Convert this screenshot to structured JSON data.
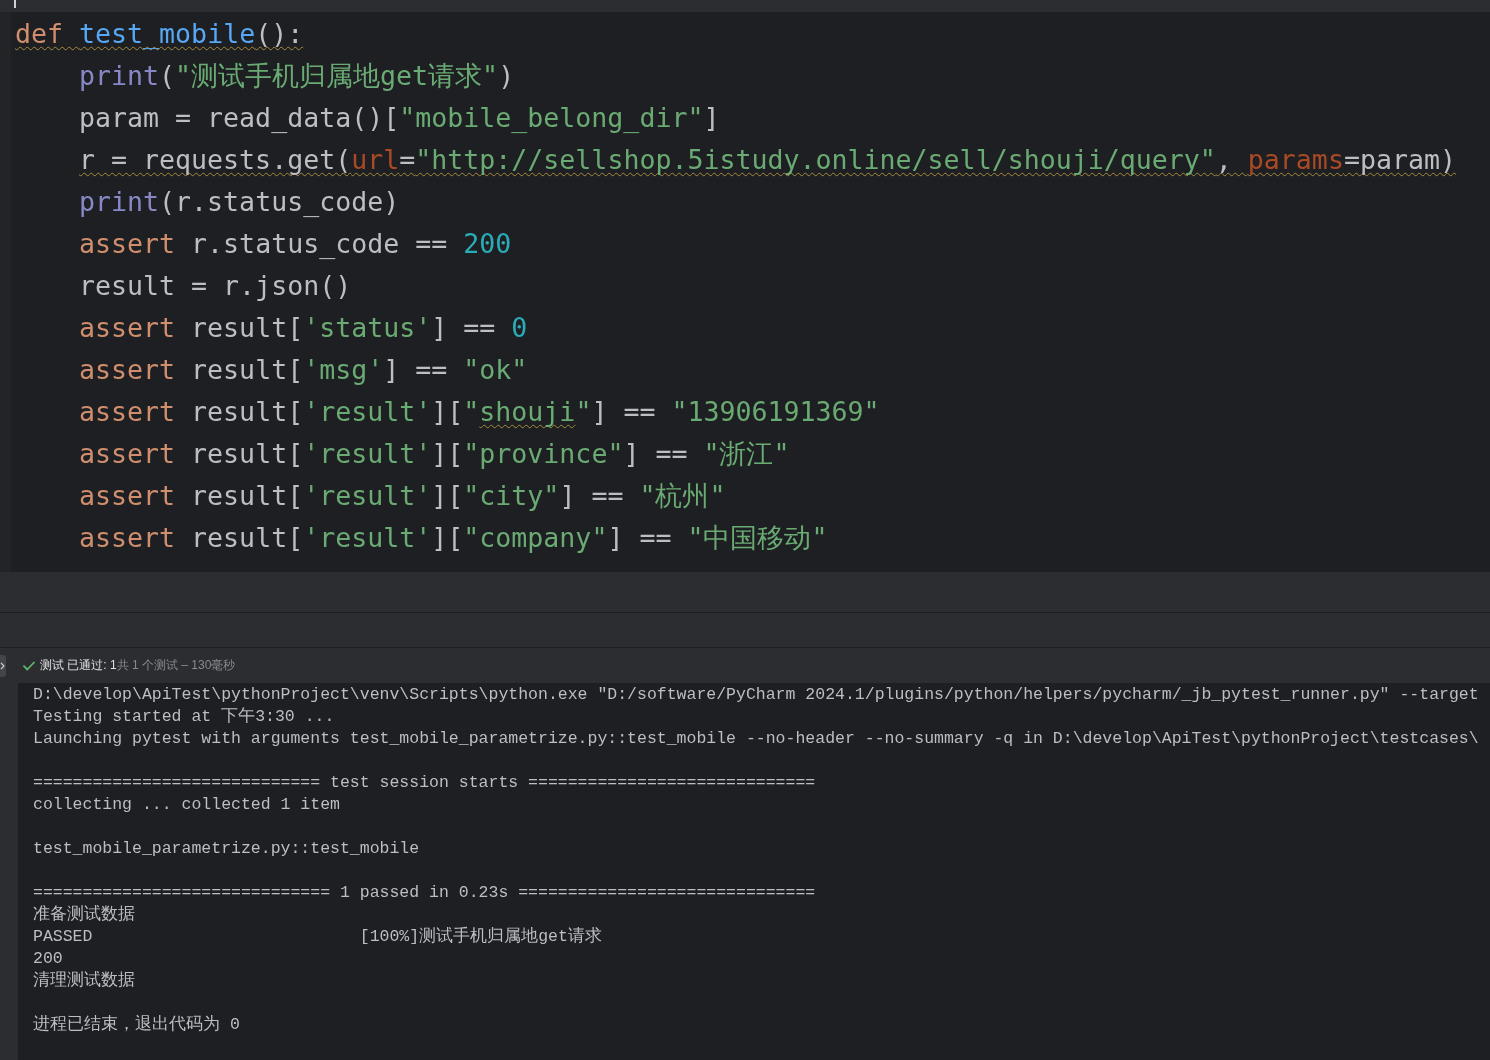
{
  "editor": {
    "code_lines": [
      {
        "tokens": [
          {
            "text": "def ",
            "kind": "keyword",
            "warning": true
          },
          {
            "text": "test_mobile",
            "kind": "function",
            "warning": true
          },
          {
            "text": "():",
            "kind": "plain",
            "warning": true
          }
        ],
        "children": [
          {
            "tokens": [
              {
                "text": "print",
                "kind": "builtin",
                "warning": false
              },
              {
                "text": "(",
                "kind": "plain",
                "warning": false
              },
              {
                "text": "\"测试手机归属地get请求\"",
                "kind": "string",
                "warning": false
              },
              {
                "text": ")",
                "kind": "plain",
                "warning": false
              }
            ]
          },
          {
            "tokens": [
              {
                "text": "param = read_data()[",
                "kind": "plain",
                "warning": false
              },
              {
                "text": "\"mobile_belong_dir\"",
                "kind": "string",
                "warning": false
              },
              {
                "text": "]",
                "kind": "plain",
                "warning": false
              }
            ]
          },
          {
            "tokens": [
              {
                "text": "r = requests.get(",
                "kind": "plain",
                "warning": true
              },
              {
                "text": "url",
                "kind": "param",
                "warning": true
              },
              {
                "text": "=",
                "kind": "plain",
                "warning": true
              },
              {
                "text": "\"http://sellshop.5istudy.online/sell/shouji/query\"",
                "kind": "string",
                "warning": true
              },
              {
                "text": ", ",
                "kind": "plain",
                "warning": true
              },
              {
                "text": "params",
                "kind": "param",
                "warning": true
              },
              {
                "text": "=param)",
                "kind": "plain",
                "warning": true
              }
            ]
          },
          {
            "tokens": [
              {
                "text": "print",
                "kind": "builtin",
                "warning": false
              },
              {
                "text": "(r.status_code)",
                "kind": "plain",
                "warning": false
              }
            ]
          },
          {
            "tokens": [
              {
                "text": "assert",
                "kind": "keyword",
                "warning": false
              },
              {
                "text": " r.status_code == ",
                "kind": "plain",
                "warning": false
              },
              {
                "text": "200",
                "kind": "number",
                "warning": false
              }
            ]
          },
          {
            "tokens": [
              {
                "text": "result = r.json()",
                "kind": "plain",
                "warning": false
              }
            ]
          },
          {
            "tokens": [
              {
                "text": "assert",
                "kind": "keyword",
                "warning": false
              },
              {
                "text": " result[",
                "kind": "plain",
                "warning": false
              },
              {
                "text": "'status'",
                "kind": "string",
                "warning": false
              },
              {
                "text": "] == ",
                "kind": "plain",
                "warning": false
              },
              {
                "text": "0",
                "kind": "number",
                "warning": false
              }
            ]
          },
          {
            "tokens": [
              {
                "text": "assert",
                "kind": "keyword",
                "warning": false
              },
              {
                "text": " result[",
                "kind": "plain",
                "warning": false
              },
              {
                "text": "'msg'",
                "kind": "string",
                "warning": false
              },
              {
                "text": "] == ",
                "kind": "plain",
                "warning": false
              },
              {
                "text": "\"ok\"",
                "kind": "string",
                "warning": false
              }
            ]
          },
          {
            "tokens": [
              {
                "text": "assert",
                "kind": "keyword",
                "warning": false
              },
              {
                "text": " result[",
                "kind": "plain",
                "warning": false
              },
              {
                "text": "'result'",
                "kind": "string",
                "warning": false
              },
              {
                "text": "][",
                "kind": "plain",
                "warning": false
              },
              {
                "text": "\"",
                "kind": "string",
                "warning": false
              },
              {
                "text": "shouji",
                "kind": "string",
                "warning": true
              },
              {
                "text": "\"",
                "kind": "string",
                "warning": false
              },
              {
                "text": "] == ",
                "kind": "plain",
                "warning": false
              },
              {
                "text": "\"13906191369\"",
                "kind": "string",
                "warning": false
              }
            ]
          },
          {
            "tokens": [
              {
                "text": "assert",
                "kind": "keyword",
                "warning": false
              },
              {
                "text": " result[",
                "kind": "plain",
                "warning": false
              },
              {
                "text": "'result'",
                "kind": "string",
                "warning": false
              },
              {
                "text": "][",
                "kind": "plain",
                "warning": false
              },
              {
                "text": "\"province\"",
                "kind": "string",
                "warning": false
              },
              {
                "text": "] == ",
                "kind": "plain",
                "warning": false
              },
              {
                "text": "\"浙江\"",
                "kind": "string",
                "warning": false
              }
            ]
          },
          {
            "tokens": [
              {
                "text": "assert",
                "kind": "keyword",
                "warning": false
              },
              {
                "text": " result[",
                "kind": "plain",
                "warning": false
              },
              {
                "text": "'result'",
                "kind": "string",
                "warning": false
              },
              {
                "text": "][",
                "kind": "plain",
                "warning": false
              },
              {
                "text": "\"city\"",
                "kind": "string",
                "warning": false
              },
              {
                "text": "] == ",
                "kind": "plain",
                "warning": false
              },
              {
                "text": "\"杭州\"",
                "kind": "string",
                "warning": false
              }
            ]
          },
          {
            "tokens": [
              {
                "text": "assert",
                "kind": "keyword",
                "warning": false
              },
              {
                "text": " result[",
                "kind": "plain",
                "warning": false
              },
              {
                "text": "'result'",
                "kind": "string",
                "warning": false
              },
              {
                "text": "][",
                "kind": "plain",
                "warning": false
              },
              {
                "text": "\"company\"",
                "kind": "string",
                "warning": false
              },
              {
                "text": "] == ",
                "kind": "plain",
                "warning": false
              },
              {
                "text": "\"中国移动\"",
                "kind": "string",
                "warning": false
              }
            ]
          }
        ]
      }
    ]
  },
  "test_results": {
    "passed": true,
    "label": "测试 已通过: 1",
    "summary": "共 1 个测试 – 130毫秒"
  },
  "console": {
    "blocks": [
      [
        "D:\\develop\\ApiTest\\pythonProject\\venv\\Scripts\\python.exe \"D:/software/PyCharm 2024.1/plugins/python/helpers/pycharm/_jb_pytest_runner.py\" --target",
        "Testing started at 下午3:30 ...",
        "Launching pytest with arguments test_mobile_parametrize.py::test_mobile --no-header --no-summary -q in D:\\develop\\ApiTest\\pythonProject\\testcases\\"
      ],
      [
        "============================= test session starts =============================",
        "collecting ... collected 1 item"
      ],
      [
        "test_mobile_parametrize.py::test_mobile"
      ],
      [
        "============================== 1 passed in 0.23s ==============================",
        "准备测试数据",
        "PASSED                           [100%]测试手机归属地get请求",
        "200",
        "清理测试数据"
      ],
      [
        "进程已结束，退出代码为 0"
      ]
    ]
  }
}
